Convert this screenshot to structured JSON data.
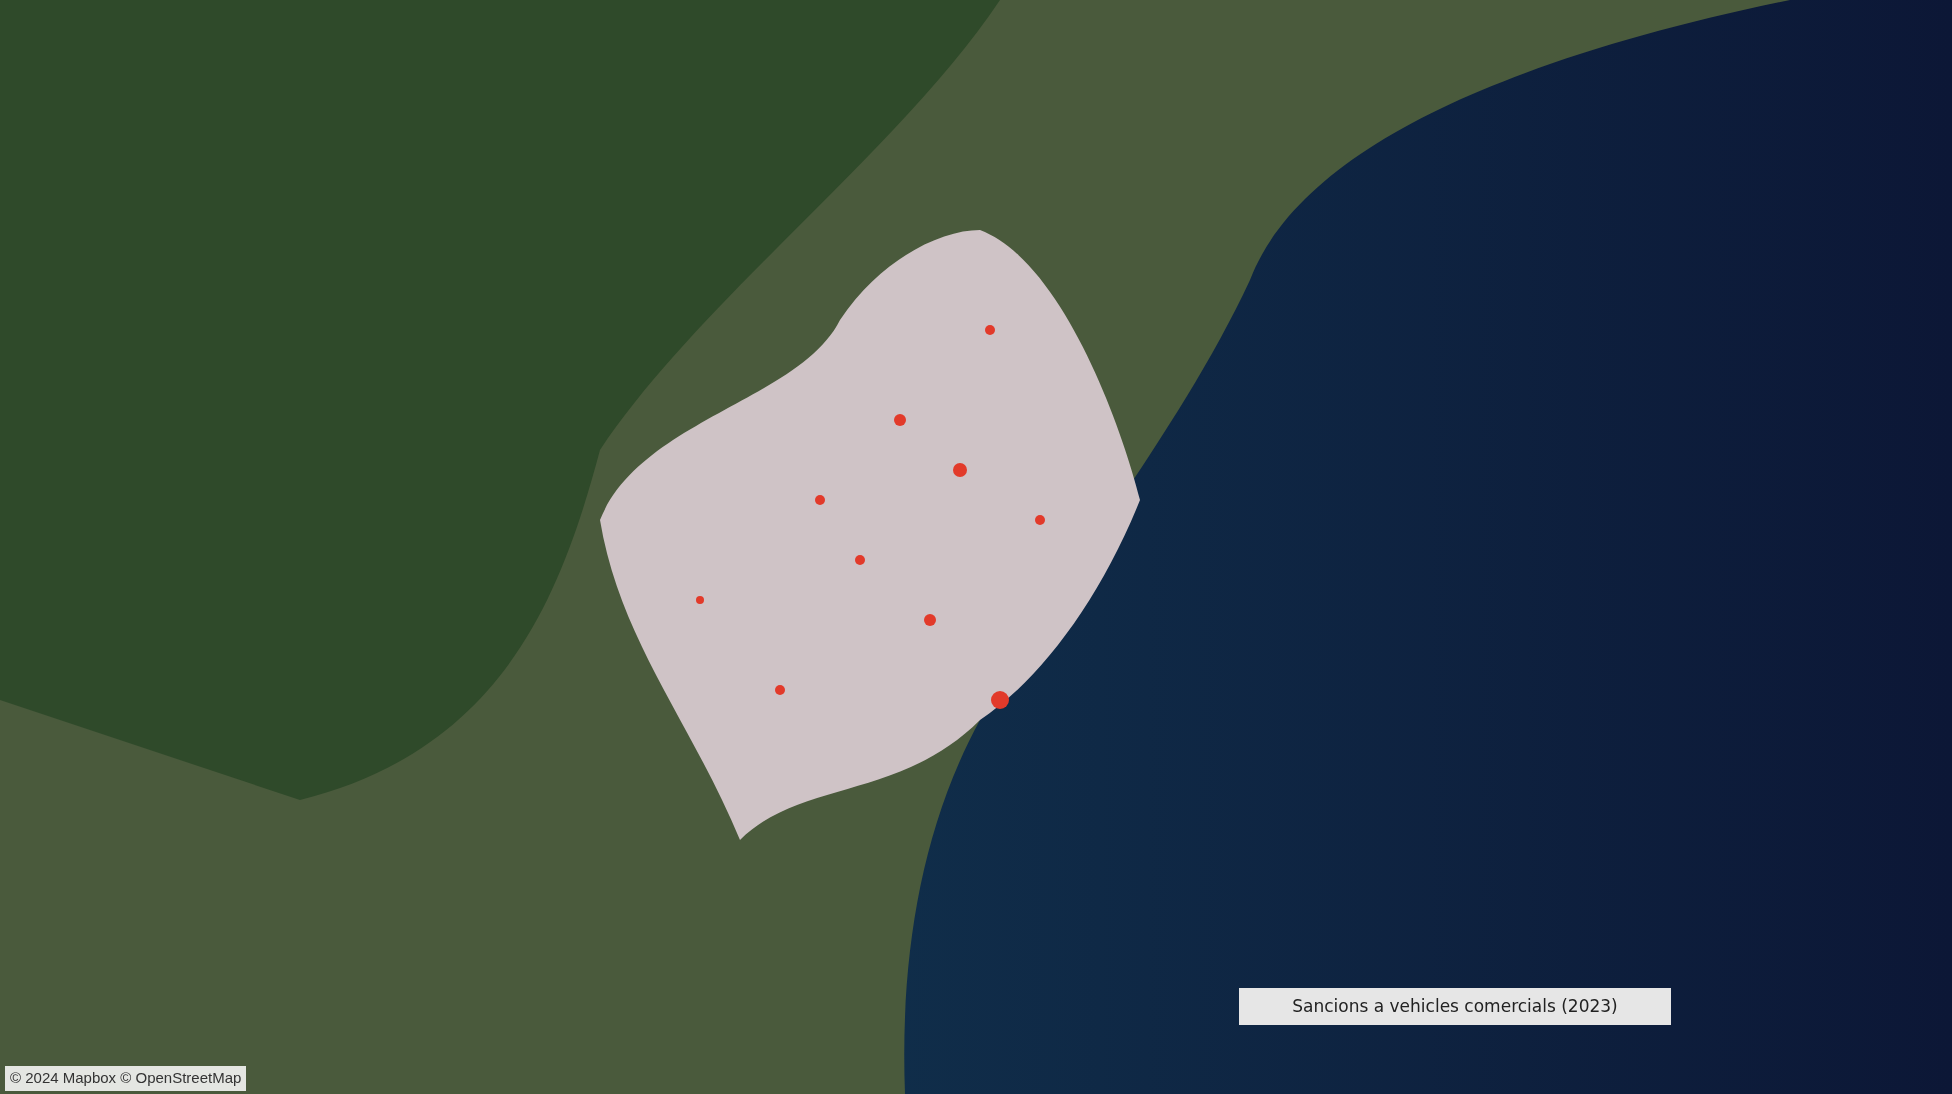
{
  "map": {
    "title": "Sancions a vehicles comercials (2023)",
    "attribution": "© 2024 Mapbox © OpenStreetMap"
  }
}
